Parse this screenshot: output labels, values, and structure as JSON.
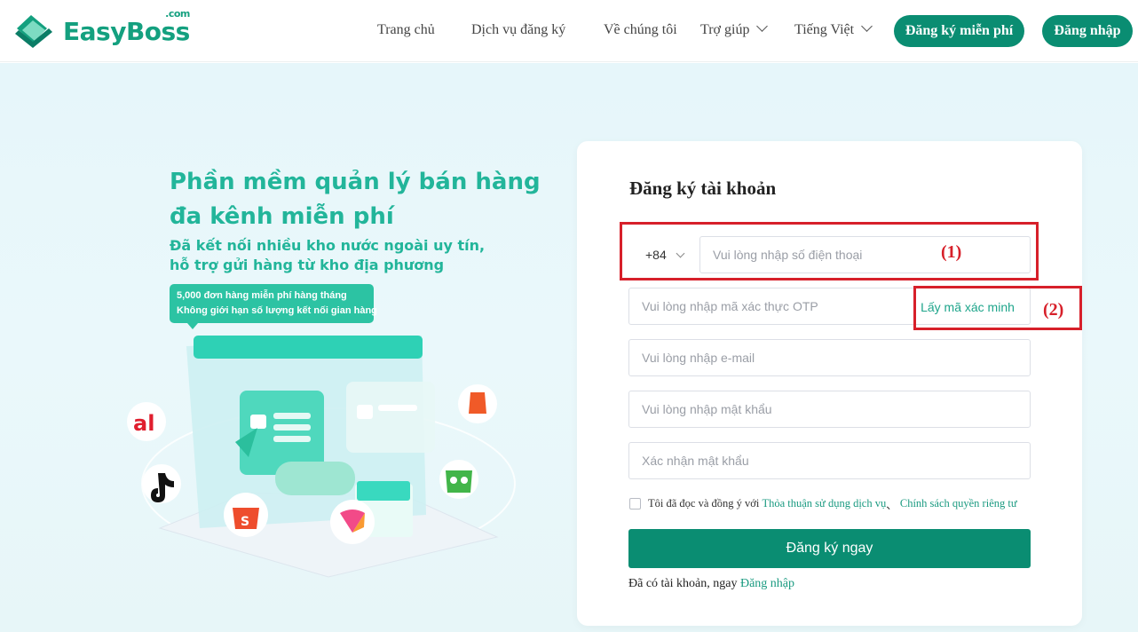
{
  "header": {
    "logo_text": "EasyBoss",
    "logo_com": ".com",
    "nav": {
      "home": "Trang chủ",
      "services": "Dịch vụ đăng ký",
      "about": "Về chúng tôi",
      "help": "Trợ giúp",
      "language": "Tiếng Việt"
    },
    "register_free": "Đăng ký miễn phí",
    "login": "Đăng nhập"
  },
  "hero": {
    "title_line1": "Phần mềm quản lý bán hàng",
    "title_line2": "đa kênh miễn phí",
    "subtitle_line1": "Đã kết nối nhiều kho nước ngoài uy tín,",
    "subtitle_line2": "hỗ trợ gửi hàng từ kho địa phương",
    "badge_line1": "5,000 đơn hàng miễn phí hàng tháng",
    "badge_line2": "Không giới hạn số lượng kết nối gian hàng"
  },
  "form": {
    "title": "Đăng ký tài khoản",
    "country_code": "+84",
    "phone_placeholder": "Vui lòng nhập số điện thoại",
    "otp_placeholder": "Vui lòng nhập mã xác thực OTP",
    "get_code": "Lấy mã xác minh",
    "email_placeholder": "Vui lòng nhập e-mail",
    "password_placeholder": "Vui lòng nhập mật khẩu",
    "confirm_placeholder": "Xác nhận mật khẩu",
    "agree_prefix": "Tôi đã đọc và đồng ý với",
    "terms_link": "Thỏa thuận sử dụng dịch vụ",
    "separator": "、",
    "privacy_link": "Chính sách quyền riêng tư",
    "submit": "Đăng ký ngay",
    "have_account": "Đã có tài khoản, ngay",
    "login_link": "Đăng nhập"
  },
  "annotations": {
    "label1": "(1)",
    "label2": "(2)"
  },
  "colors": {
    "brand": "#0a8d72",
    "accent": "#22b59a",
    "annotation": "#d7202a"
  }
}
